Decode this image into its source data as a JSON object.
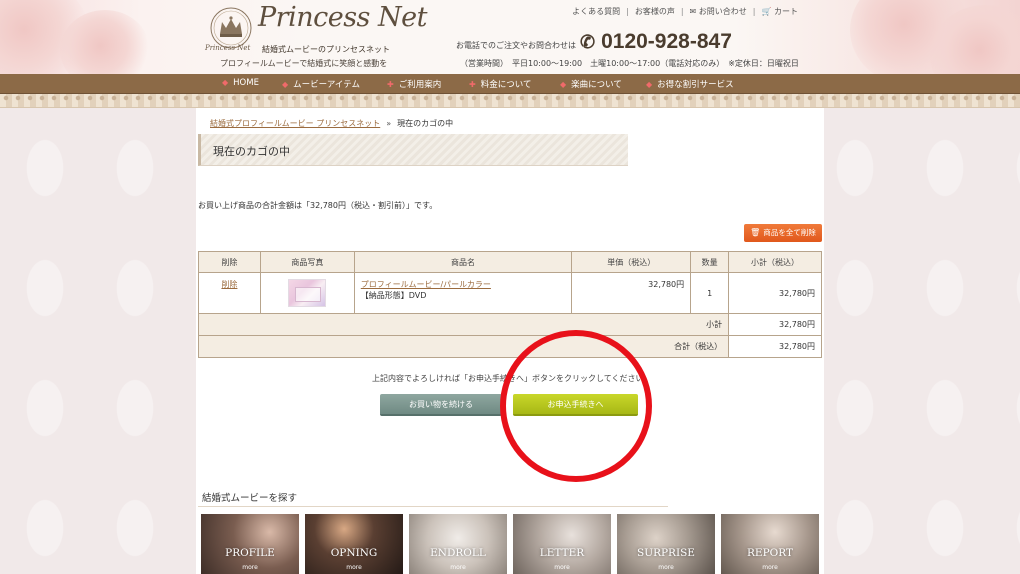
{
  "header": {
    "logo_crown_text": "Princess Net",
    "logo_script": "Princess Net",
    "logo_sub": "結婚式ムービーのプリンセスネット",
    "tagline": "プロフィールムービーで結婚式に笑顔と感動を",
    "top_links": [
      "よくある質問",
      "お客様の声",
      "お問い合わせ",
      "カート"
    ],
    "phone_label": "お電話でのご注文やお問合わせは",
    "phone_number": "0120-928-847",
    "hours": "（営業時間）　平日10:00～19:00　土曜10:00～17:00（電話対応のみ）　※定休日：日曜祝日"
  },
  "nav": {
    "items": [
      "HOME",
      "ムービーアイテム",
      "ご利用案内",
      "料金について",
      "楽曲について",
      "お得な割引サービス"
    ]
  },
  "breadcrumb": {
    "home": "結婚式プロフィールムービー プリンセスネット",
    "separator": "»",
    "current": "現在のカゴの中"
  },
  "page_title": "現在のカゴの中",
  "total_message": "お買い上げ商品の合計金額は「32,780円（税込・割引前）」です。",
  "delete_all_label": "商品を全て削除",
  "cart": {
    "headers": [
      "削除",
      "商品写真",
      "商品名",
      "単価（税込）",
      "数量",
      "小計（税込）"
    ],
    "rows": [
      {
        "delete": "削除",
        "name": "プロフィールムービー/パールカラー",
        "option": "【納品形態】DVD",
        "unit_price": "32,780円",
        "qty": "1",
        "subtotal": "32,780円"
      }
    ],
    "subtotal_label": "小計",
    "subtotal_value": "32,780円",
    "total_label": "合計（税込）",
    "total_value": "32,780円"
  },
  "instruction": "上記内容でよろしければ「お申込手続きへ」ボタンをクリックしてください。",
  "buttons": {
    "continue": "お買い物を続ける",
    "checkout": "お申込手続きへ"
  },
  "search": {
    "title": "結婚式ムービーを探す",
    "more": "more",
    "categories": [
      {
        "label": "PROFILE",
        "color": "#5a4438"
      },
      {
        "label": "OPNING",
        "color": "#3a2b24"
      },
      {
        "label": "ENDROLL",
        "color": "#bfb6ad"
      },
      {
        "label": "LETTER",
        "color": "#b8ada6"
      },
      {
        "label": "SURPRISE",
        "color": "#a79c92"
      },
      {
        "label": "REPORT",
        "color": "#a5968b"
      }
    ]
  },
  "colors": {
    "nav_bg": "#8c6a47",
    "link": "#9b6b3e",
    "delete_all_btn": "#e1581c",
    "continue_btn": "#6f8a83",
    "checkout_btn": "#a7b816",
    "annotation": "#e8111a"
  }
}
